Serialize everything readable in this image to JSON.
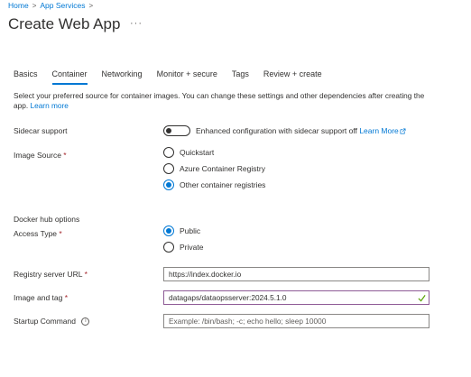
{
  "breadcrumb": {
    "items": [
      "Home",
      "App Services"
    ],
    "separator": ">"
  },
  "page": {
    "title": "Create Web App",
    "more": "···"
  },
  "tabs": [
    {
      "label": "Basics",
      "active": false
    },
    {
      "label": "Container",
      "active": true
    },
    {
      "label": "Networking",
      "active": false
    },
    {
      "label": "Monitor + secure",
      "active": false
    },
    {
      "label": "Tags",
      "active": false
    },
    {
      "label": "Review + create",
      "active": false
    }
  ],
  "description": {
    "text": "Select your preferred source for container images. You can change these settings and other dependencies after creating the app.",
    "link": "Learn more"
  },
  "sidecar": {
    "label": "Sidecar support",
    "toggle_state": "off",
    "text": "Enhanced configuration with sidecar support off",
    "link": "Learn More"
  },
  "image_source": {
    "label": "Image Source",
    "required": "*",
    "options": [
      "Quickstart",
      "Azure Container Registry",
      "Other container registries"
    ],
    "selected": "Other container registries"
  },
  "docker_hub": {
    "header": "Docker hub options"
  },
  "access_type": {
    "label": "Access Type",
    "required": "*",
    "options": [
      "Public",
      "Private"
    ],
    "selected": "Public"
  },
  "registry_url": {
    "label": "Registry server URL",
    "required": "*",
    "value": "https://index.docker.io"
  },
  "image_tag": {
    "label": "Image and tag",
    "required": "*",
    "value": "datagaps/dataopsserver:2024.5.1.0"
  },
  "startup_command": {
    "label": "Startup Command",
    "value": "",
    "placeholder": "Example: /bin/bash; -c; echo hello; sleep 10000"
  },
  "colors": {
    "accent": "#0078d4",
    "required": "#a4262c",
    "valid_border": "#8e5b96",
    "valid_check": "#57a300"
  }
}
